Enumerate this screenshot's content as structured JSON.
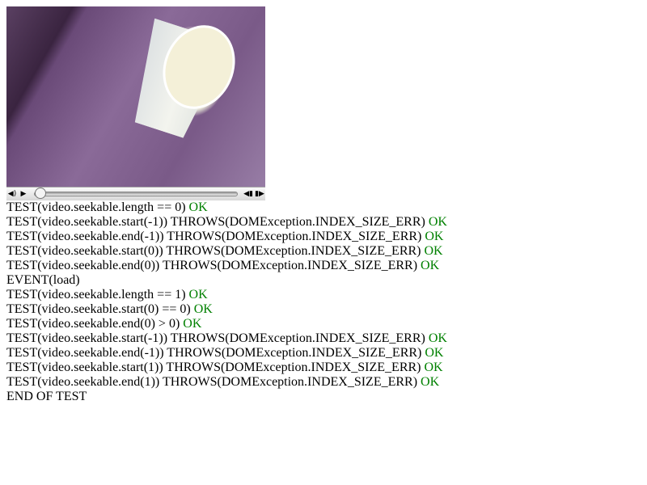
{
  "video": {
    "controls": {
      "mute_icon": "speaker-icon",
      "play_icon": "play-icon",
      "seek_back_icon": "rewind-icon",
      "seek_forward_icon": "forward-icon",
      "progress": 0
    }
  },
  "log": [
    {
      "text": "TEST(video.seekable.length == 0)",
      "result": "OK"
    },
    {
      "text": "TEST(video.seekable.start(-1)) THROWS(DOMException.INDEX_SIZE_ERR)",
      "result": "OK"
    },
    {
      "text": "TEST(video.seekable.end(-1)) THROWS(DOMException.INDEX_SIZE_ERR)",
      "result": "OK"
    },
    {
      "text": "TEST(video.seekable.start(0)) THROWS(DOMException.INDEX_SIZE_ERR)",
      "result": "OK"
    },
    {
      "text": "TEST(video.seekable.end(0)) THROWS(DOMException.INDEX_SIZE_ERR)",
      "result": "OK"
    },
    {
      "text": "EVENT(load)",
      "result": ""
    },
    {
      "text": "TEST(video.seekable.length == 1)",
      "result": "OK"
    },
    {
      "text": "TEST(video.seekable.start(0) == 0)",
      "result": "OK"
    },
    {
      "text": "TEST(video.seekable.end(0) > 0)",
      "result": "OK"
    },
    {
      "text": "TEST(video.seekable.start(-1)) THROWS(DOMException.INDEX_SIZE_ERR)",
      "result": "OK"
    },
    {
      "text": "TEST(video.seekable.end(-1)) THROWS(DOMException.INDEX_SIZE_ERR)",
      "result": "OK"
    },
    {
      "text": "TEST(video.seekable.start(1)) THROWS(DOMException.INDEX_SIZE_ERR)",
      "result": "OK"
    },
    {
      "text": "TEST(video.seekable.end(1)) THROWS(DOMException.INDEX_SIZE_ERR)",
      "result": "OK"
    },
    {
      "text": "END OF TEST",
      "result": ""
    }
  ]
}
